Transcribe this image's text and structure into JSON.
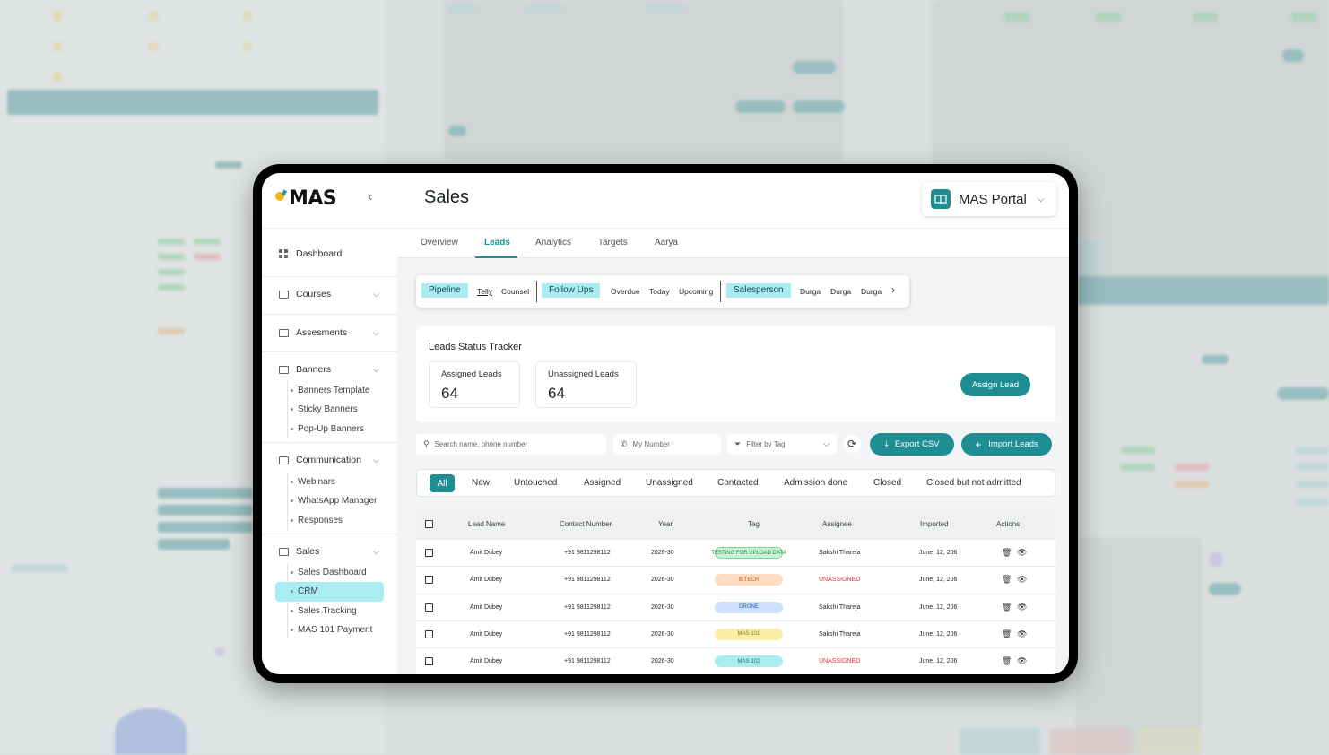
{
  "app": {
    "logo": "MAS",
    "page_title": "Sales",
    "portal_label": "MAS Portal"
  },
  "colors": {
    "accent": "#1f8e93",
    "highlight": "#a9ecf2",
    "unassigned": "#e23a3a"
  },
  "icons": [
    "logo-bulb-icon",
    "chevron-left-icon",
    "book-icon",
    "chevron-down-icon",
    "grid-icon",
    "search-icon",
    "phone-icon",
    "filter-icon",
    "refresh-icon",
    "download-icon",
    "plus-icon",
    "trash-icon",
    "eye-icon",
    "chevron-right-icon"
  ],
  "sidebar": {
    "dashboard": "Dashboard",
    "groups": [
      {
        "label": "Courses"
      },
      {
        "label": "Assesments"
      },
      {
        "label": "Banners",
        "items": [
          "Banners Template",
          "Sticky Banners",
          "Pop-Up Banners"
        ]
      },
      {
        "label": "Communication",
        "items": [
          "Webinars",
          "WhatsApp Manager",
          "Responses"
        ]
      },
      {
        "label": "Sales",
        "items": [
          "Sales Dashboard",
          "CRM",
          "Sales Tracking",
          "MAS 101 Payment"
        ]
      }
    ],
    "active_item": "CRM"
  },
  "tabs": [
    "Overview",
    "Leads",
    "Analytics",
    "Targets",
    "Aarya"
  ],
  "active_tab": "Leads",
  "filters": {
    "pipeline": "Pipeline",
    "pipeline_items": [
      "Telly",
      "Counsel"
    ],
    "followups": "Follow Ups",
    "followup_items": [
      "Overdue",
      "Today",
      "Upcoming"
    ],
    "salesperson": "Salesperson",
    "salesperson_items": [
      "Durga",
      "Durga",
      "Durga"
    ]
  },
  "tracker": {
    "title": "Leads Status Tracker",
    "assigned_label": "Assigned Leads",
    "assigned_value": "64",
    "unassigned_label": "Unassigned Leads",
    "unassigned_value": "64",
    "assign_button": "Assign Lead"
  },
  "search": {
    "placeholder": "Search name, phone number",
    "number_placeholder": "My Number",
    "tag_placeholder": "Filter by Tag",
    "export_label": "Export CSV",
    "import_label": "Import Leads"
  },
  "status_tabs": [
    "All",
    "New",
    "Untouched",
    "Assigned",
    "Unassigned",
    "Contacted",
    "Admission done",
    "Closed",
    "Closed but not admitted"
  ],
  "table": {
    "columns": [
      "Lead Name",
      "Contact Number",
      "Year",
      "Tag",
      "Assignee",
      "Imported",
      "Actions"
    ],
    "rows": [
      {
        "name": "Amit Dubey",
        "contact": "+91 9811298112",
        "year": "2026-30",
        "tag": "TESTING FOR UPLOAD DATA",
        "tag_bg": "#c9f2d4",
        "tag_fg": "#2b8a45",
        "tag_border": "#7fd69a",
        "assignee": "Sakshi Thareja",
        "unassigned": false,
        "imported": "June, 12, 206"
      },
      {
        "name": "Amit Dubey",
        "contact": "+91 9811298112",
        "year": "2026-30",
        "tag": "B.TECH",
        "tag_bg": "#fddcc2",
        "tag_fg": "#c0561b",
        "tag_border": "#fddcc2",
        "assignee": "UNASSIGNED",
        "unassigned": true,
        "imported": "June, 12, 206"
      },
      {
        "name": "Amit Dubey",
        "contact": "+91 9811298112",
        "year": "2026-30",
        "tag": "DRONE",
        "tag_bg": "#cfe0fb",
        "tag_fg": "#2556b8",
        "tag_border": "#cfe0fb",
        "assignee": "Sakshi Thareja",
        "unassigned": false,
        "imported": "June, 12, 206"
      },
      {
        "name": "Amit Dubey",
        "contact": "+91 9811298112",
        "year": "2026-30",
        "tag": "MAS 101",
        "tag_bg": "#fbeea8",
        "tag_fg": "#8a6d05",
        "tag_border": "#fbeea8",
        "assignee": "Sakshi Thareja",
        "unassigned": false,
        "imported": "June, 12, 206"
      },
      {
        "name": "Amit Dubey",
        "contact": "+91 9811298112",
        "year": "2026-30",
        "tag": "MAS 102",
        "tag_bg": "#a9ecf2",
        "tag_fg": "#1b6a70",
        "tag_border": "#a9ecf2",
        "assignee": "UNASSIGNED",
        "unassigned": true,
        "imported": "June, 12, 206"
      }
    ]
  }
}
